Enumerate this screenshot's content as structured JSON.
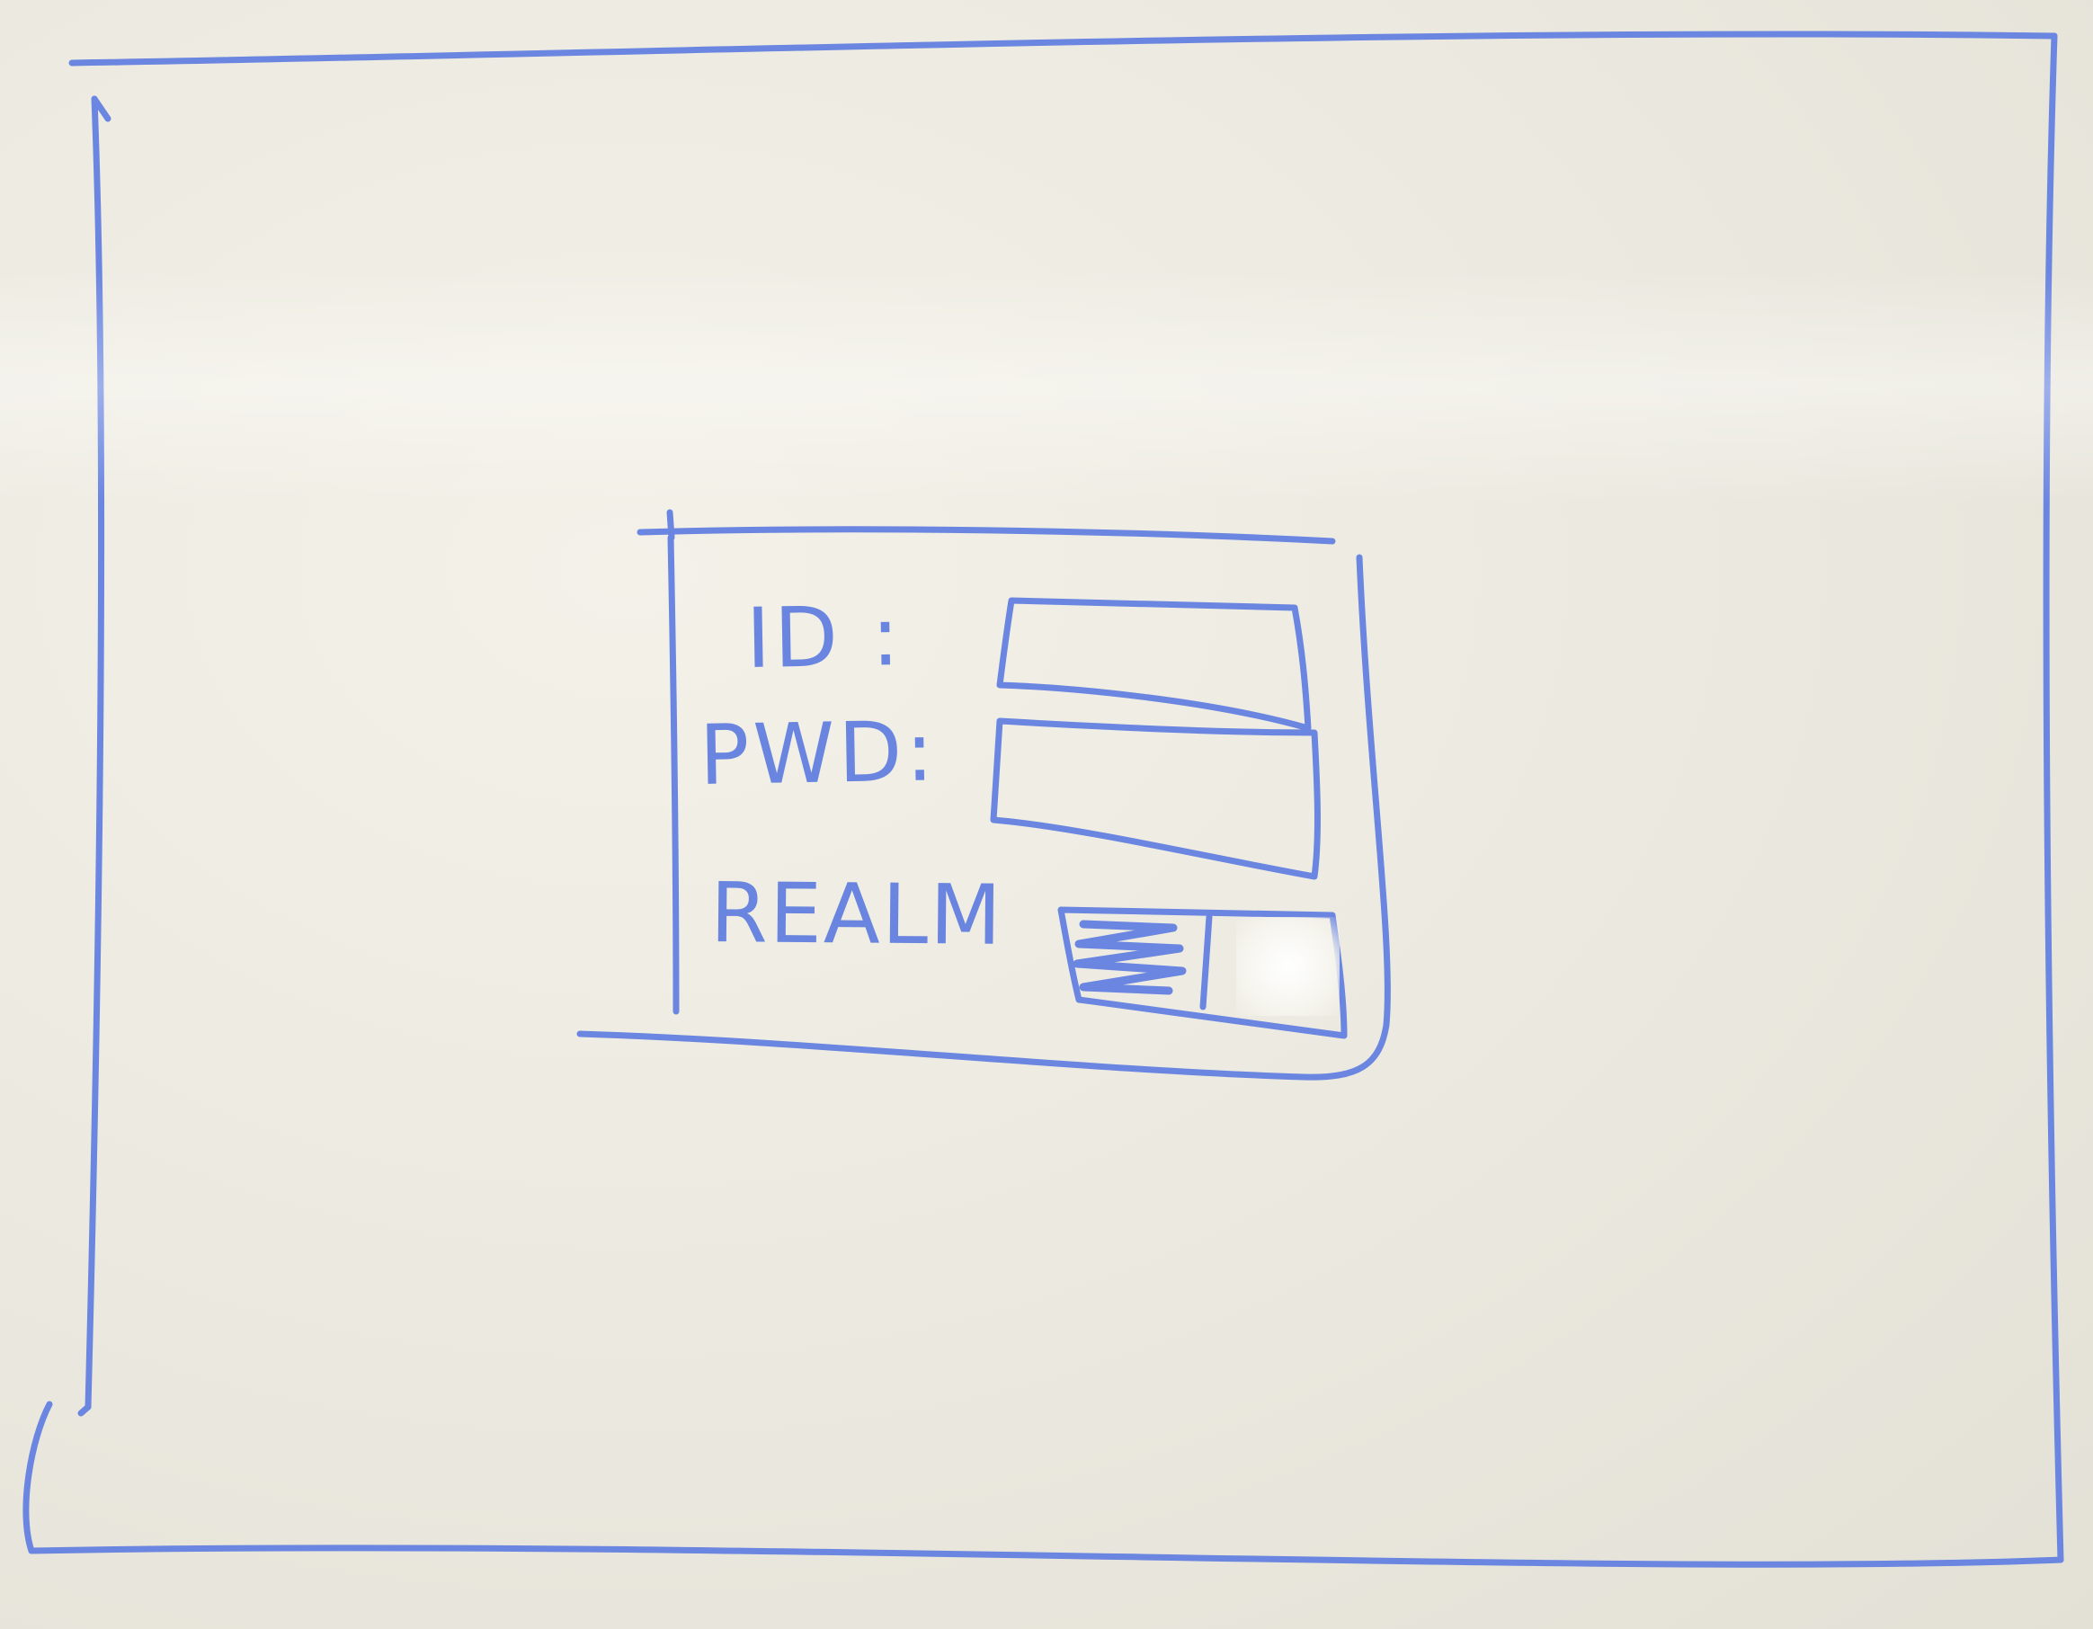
{
  "login_form": {
    "id_label": "ID :",
    "pwd_label": "PWD:",
    "realm_label": "REALM"
  },
  "colors": {
    "ink": "#6b86e0",
    "board": "#eceae1"
  }
}
